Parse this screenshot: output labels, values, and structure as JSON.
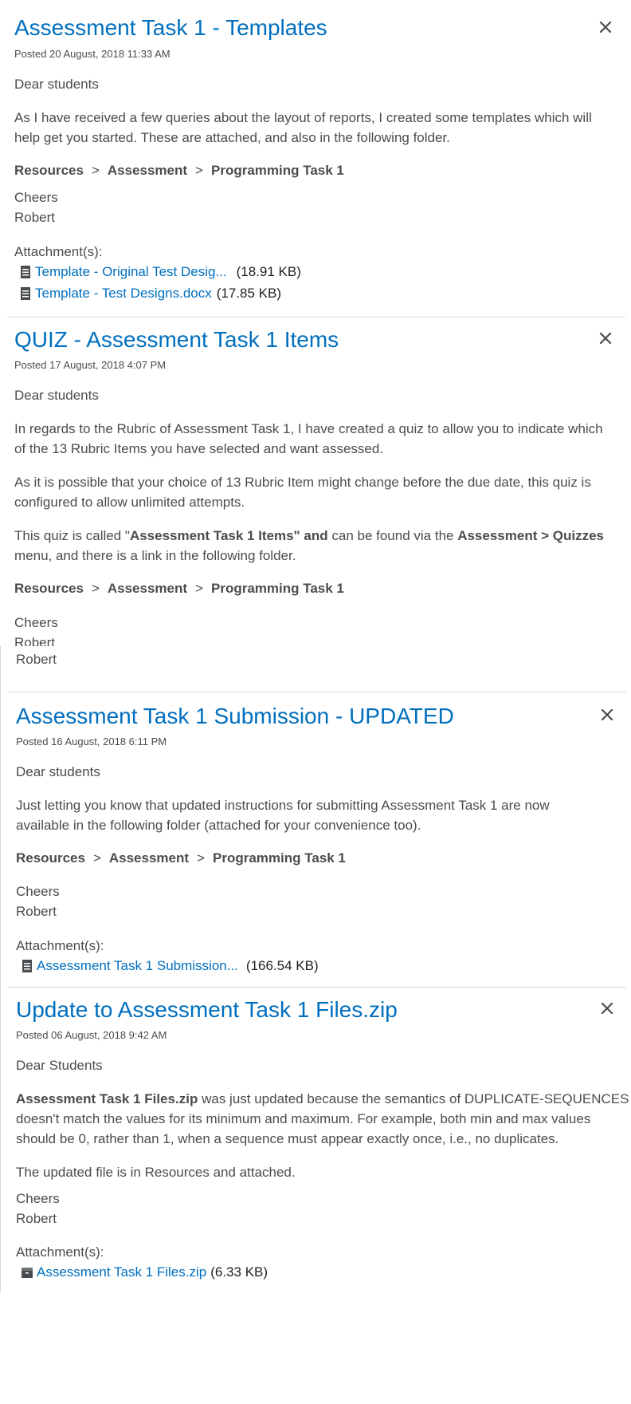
{
  "posts": [
    {
      "title": "Assessment Task 1 - Templates",
      "date": "Posted 20 August, 2018 11:33 AM",
      "greeting": "Dear students",
      "body1_line1": "As I have received a few queries about the layout of reports, I created some templates which will",
      "body1_line2": "help get you started. These are attached, and also in the following folder.",
      "path": [
        "Resources",
        "Assessment",
        "Programming Task 1"
      ],
      "path_sep": ">",
      "signoff": "Cheers",
      "name": "Robert",
      "attachments_label": "Attachment(s):",
      "attachments": [
        {
          "name": "Template - Original Test Desig...",
          "size": "(18.91 KB)",
          "icon": "document-icon"
        },
        {
          "name": "Template - Test Designs.docx",
          "size": "(17.85 KB)",
          "icon": "document-icon"
        }
      ]
    },
    {
      "title": "QUIZ - Assessment Task 1 Items",
      "date": "Posted 17 August, 2018 4:07 PM",
      "greeting": "Dear students",
      "body1_line1": "In regards to the Rubric of Assessment Task 1, I have created a quiz to allow you to indicate which",
      "body1_line2": "of the 13 Rubric Items you have selected and want assessed.",
      "body2_line1": "As it is possible that your choice of 13 Rubric Item might change before the due date, this quiz is",
      "body2_line2": "configured to allow unlimited attempts.",
      "body3_pre": "This quiz is called \"",
      "body3_bold1": "Assessment Task 1 Items\" and",
      "body3_mid": " can be found via the ",
      "body3_bold2": "Assessment > Quizzes",
      "body3_line2": "menu, and there is a link in the following folder.",
      "path": [
        "Resources",
        "Assessment",
        "Programming Task 1"
      ],
      "path_sep": ">",
      "signoff": "Cheers",
      "name": "Robert"
    },
    {
      "title": "Assessment Task 1 Submission - UPDATED",
      "date": "Posted 16 August, 2018 6:11 PM",
      "greeting": "Dear students",
      "body1_line1": "Just letting you know that updated instructions for submitting Assessment Task 1 are now",
      "body1_line2": "available in the following folder (attached for your convenience too).",
      "path": [
        "Resources",
        "Assessment",
        "Programming Task 1"
      ],
      "path_sep": ">",
      "signoff": "Cheers",
      "name": "Robert",
      "attachments_label": "Attachment(s):",
      "attachments": [
        {
          "name": "Assessment Task 1 Submission...",
          "size": "(166.54 KB)",
          "icon": "document-icon"
        }
      ]
    },
    {
      "title": "Update to Assessment Task 1 Files.zip",
      "date": "Posted 06 August, 2018 9:42 AM",
      "greeting": "Dear Students",
      "body1_bold": "Assessment Task 1 Files.zip",
      "body1_line1_rest": " was just updated because the semantics of DUPLICATE-SEQUENCES",
      "body1_line2": "doesn't match the values for its minimum and maximum. For example, both min and max values",
      "body1_line3": "should be 0, rather than 1, when a sequence must appear exactly once, i.e., no duplicates.",
      "body2": "The updated file is in Resources and attached.",
      "signoff": "Cheers",
      "name": "Robert",
      "attachments_label": "Attachment(s):",
      "attachments": [
        {
          "name": "Assessment Task 1 Files.zip",
          "size": "(6.33 KB)",
          "icon": "archive-icon"
        }
      ]
    }
  ],
  "close_icon": "close-icon",
  "colors": {
    "link": "#006fbf",
    "text": "#494c4e",
    "divider": "#d3d9e3"
  }
}
